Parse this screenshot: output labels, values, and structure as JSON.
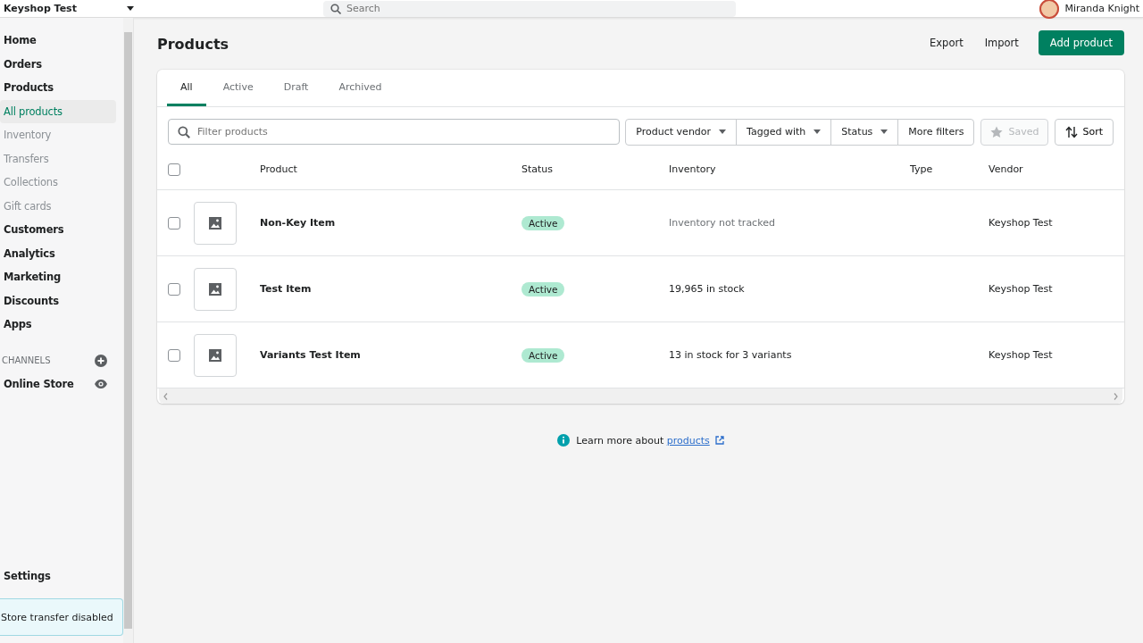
{
  "top_bar": {
    "store_name": "Keyshop Test",
    "search": {
      "placeholder": "Search"
    },
    "user_name": "Miranda Knight"
  },
  "sidebar": {
    "items": [
      {
        "label": "Home",
        "selected": false
      },
      {
        "label": "Orders",
        "selected": false
      },
      {
        "label": "Products",
        "selected": false,
        "children": [
          {
            "label": "All products",
            "selected": true
          },
          {
            "label": "Inventory",
            "selected": false
          },
          {
            "label": "Transfers",
            "selected": false
          },
          {
            "label": "Collections",
            "selected": false
          },
          {
            "label": "Gift cards",
            "selected": false
          }
        ]
      },
      {
        "label": "Customers",
        "selected": false
      },
      {
        "label": "Analytics",
        "selected": false
      },
      {
        "label": "Marketing",
        "selected": false
      },
      {
        "label": "Discounts",
        "selected": false
      },
      {
        "label": "Apps",
        "selected": false
      }
    ],
    "channels_heading": "CHANNELS",
    "channels": [
      {
        "label": "Online Store",
        "selected": false
      }
    ],
    "settings": "Settings",
    "banner": "Store transfer disabled"
  },
  "page": {
    "title": "Products",
    "actions": [
      "Export",
      "Import"
    ],
    "primary_action": "Add product"
  },
  "tabs": [
    {
      "label": "All",
      "selected": true
    },
    {
      "label": "Active",
      "selected": false
    },
    {
      "label": "Draft",
      "selected": false
    },
    {
      "label": "Archived",
      "selected": false
    }
  ],
  "filters": {
    "search": {
      "placeholder": "Filter products"
    },
    "dropdowns": [
      "Product vendor",
      "Tagged with",
      "Status"
    ],
    "more": "More filters",
    "saved": {
      "label": "Saved",
      "disabled": true
    },
    "sort": "Sort"
  },
  "table": {
    "select_all": {
      "checked": false
    },
    "columns": [
      "Product",
      "Status",
      "Inventory",
      "Type",
      "Vendor"
    ],
    "rows": [
      {
        "selected": false,
        "product": "Non-Key Item",
        "status": "Active",
        "inventory": "Inventory not tracked",
        "tracked": false,
        "type": "",
        "vendor": "Keyshop Test"
      },
      {
        "selected": false,
        "product": "Test Item",
        "status": "Active",
        "inventory": "19,965 in stock",
        "tracked": true,
        "type": "",
        "vendor": "Keyshop Test"
      },
      {
        "selected": false,
        "product": "Variants Test Item",
        "status": "Active",
        "inventory": "13 in stock for 3 variants",
        "tracked": true,
        "type": "",
        "vendor": "Keyshop Test"
      }
    ]
  },
  "footer": {
    "text": "Learn more about ",
    "link": "products"
  }
}
